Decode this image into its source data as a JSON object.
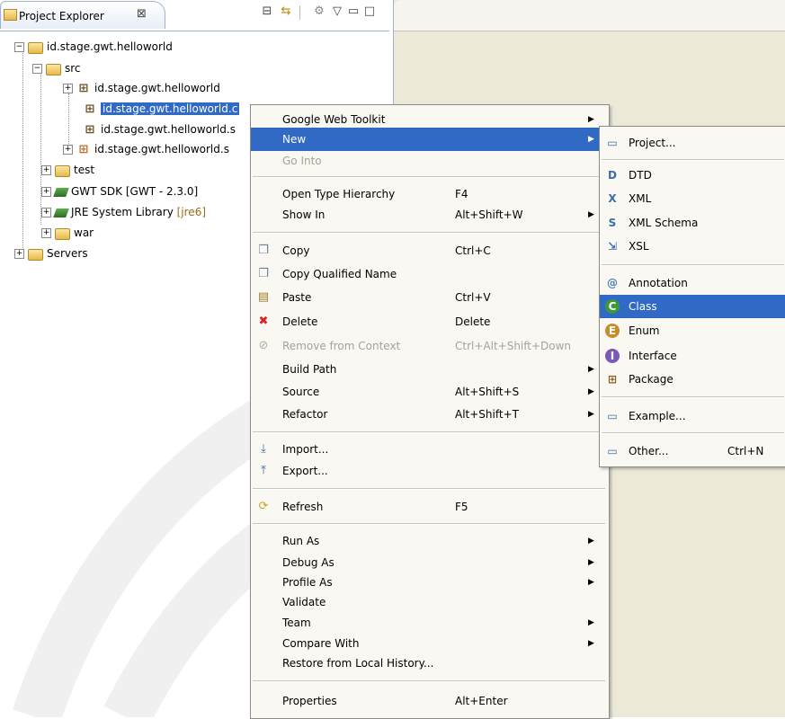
{
  "view": {
    "tab_title": "Project Explorer",
    "close_glyph": "⊠"
  },
  "tree": {
    "root": "id.stage.gwt.helloworld",
    "src": "src",
    "pkg1": "id.stage.gwt.helloworld",
    "pkg2": "id.stage.gwt.helloworld.c",
    "pkg3": "id.stage.gwt.helloworld.s",
    "pkg4": "id.stage.gwt.helloworld.s",
    "test": "test",
    "gwt_sdk": "GWT SDK [GWT - 2.3.0]",
    "jre": "JRE System Library",
    "jre_tag": "[jre6]",
    "war": "war",
    "servers": "Servers"
  },
  "context_menu": {
    "google_web_toolkit": "Google Web Toolkit",
    "new": "New",
    "go_into": "Go Into",
    "open_type_hierarchy": "Open Type Hierarchy",
    "open_type_hierarchy_key": "F4",
    "show_in": "Show In",
    "show_in_key": "Alt+Shift+W",
    "copy": "Copy",
    "copy_key": "Ctrl+C",
    "copy_qualified_name": "Copy Qualified Name",
    "paste": "Paste",
    "paste_key": "Ctrl+V",
    "delete": "Delete",
    "delete_key": "Delete",
    "remove_from_context": "Remove from Context",
    "remove_from_context_key": "Ctrl+Alt+Shift+Down",
    "build_path": "Build Path",
    "source": "Source",
    "source_key": "Alt+Shift+S",
    "refactor": "Refactor",
    "refactor_key": "Alt+Shift+T",
    "import": "Import...",
    "export": "Export...",
    "refresh": "Refresh",
    "refresh_key": "F5",
    "run_as": "Run As",
    "debug_as": "Debug As",
    "profile_as": "Profile As",
    "validate": "Validate",
    "team": "Team",
    "compare_with": "Compare With",
    "restore_from_local_history": "Restore from Local History...",
    "properties": "Properties",
    "properties_key": "Alt+Enter"
  },
  "submenu": {
    "project": "Project...",
    "dtd": "DTD",
    "xml": "XML",
    "xml_schema": "XML Schema",
    "xsl": "XSL",
    "annotation": "Annotation",
    "class": "Class",
    "enum": "Enum",
    "interface": "Interface",
    "package": "Package",
    "example": "Example...",
    "other": "Other...",
    "other_key": "Ctrl+N"
  },
  "colors": {
    "selection": "#316ac5",
    "menu_bg": "#f9f8f3",
    "panel_bg": "#ece9d8"
  }
}
